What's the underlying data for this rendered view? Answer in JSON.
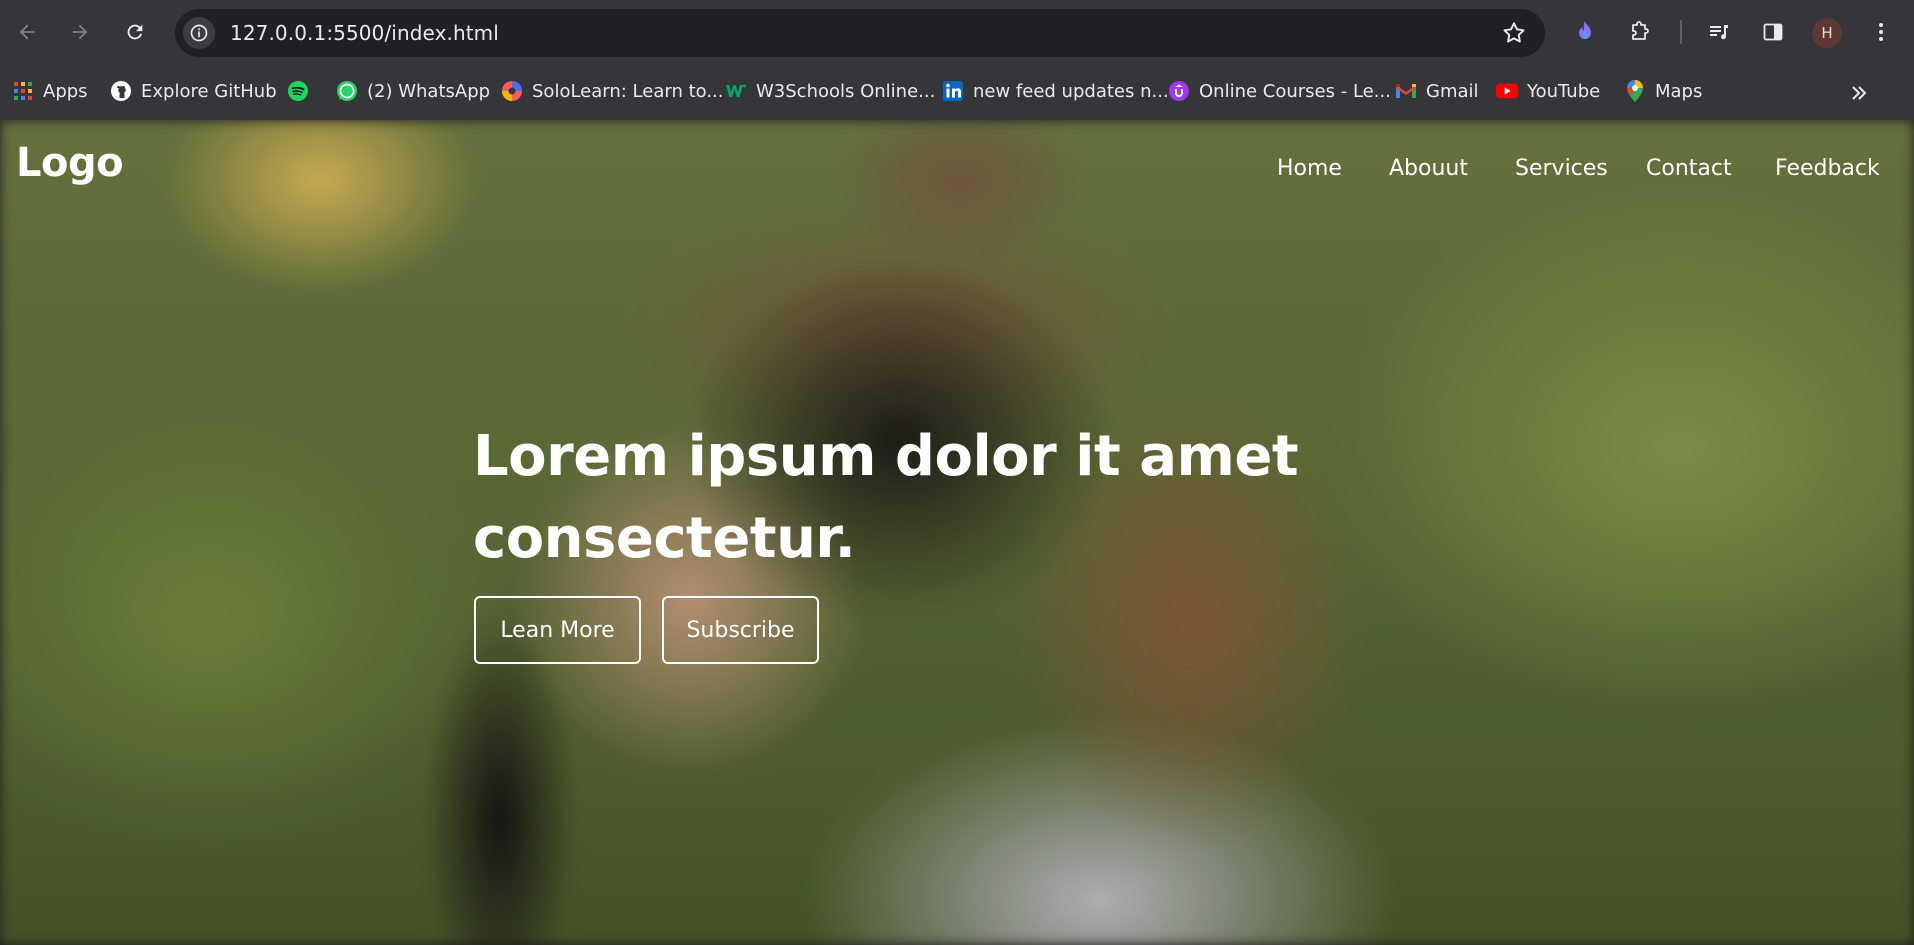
{
  "browser": {
    "url": "127.0.0.1:5500/index.html",
    "profile_initial": "H",
    "toolbar_icons": [
      "back-icon",
      "forward-icon",
      "reload-icon",
      "site-info-icon",
      "star-icon",
      "extension-flame-icon",
      "puzzle-icon",
      "media-queue-icon",
      "side-panel-icon",
      "menu-kebab-icon"
    ],
    "bookmarks": [
      {
        "label": "Apps",
        "icon": "apps-grid-icon"
      },
      {
        "label": "Explore GitHub",
        "icon": "github-icon"
      },
      {
        "label": "",
        "icon": "spotify-icon"
      },
      {
        "label": "(2) WhatsApp",
        "icon": "whatsapp-icon"
      },
      {
        "label": "SoloLearn: Learn to...",
        "icon": "sololearn-icon"
      },
      {
        "label": "W3Schools Online...",
        "icon": "w3schools-icon"
      },
      {
        "label": "new feed updates n...",
        "icon": "linkedin-icon"
      },
      {
        "label": "Online Courses - Le...",
        "icon": "udemy-icon"
      },
      {
        "label": "Gmail",
        "icon": "gmail-icon"
      },
      {
        "label": "YouTube",
        "icon": "youtube-icon"
      },
      {
        "label": "Maps",
        "icon": "maps-icon"
      }
    ]
  },
  "site": {
    "logo": "Logo",
    "nav": [
      "Home",
      "Abouut",
      "Services",
      "Contact",
      "Feedback"
    ],
    "headline_line1": "Lorem ipsum dolor it amet",
    "headline_line2": "consectetur.",
    "buttons": {
      "learn": "Lean More",
      "subscribe": "Subscribe"
    }
  },
  "colors": {
    "chrome_bg": "#35363a",
    "omnibox_bg": "#202124",
    "text_light": "#e8eaed",
    "hero_text": "#ffffff"
  }
}
